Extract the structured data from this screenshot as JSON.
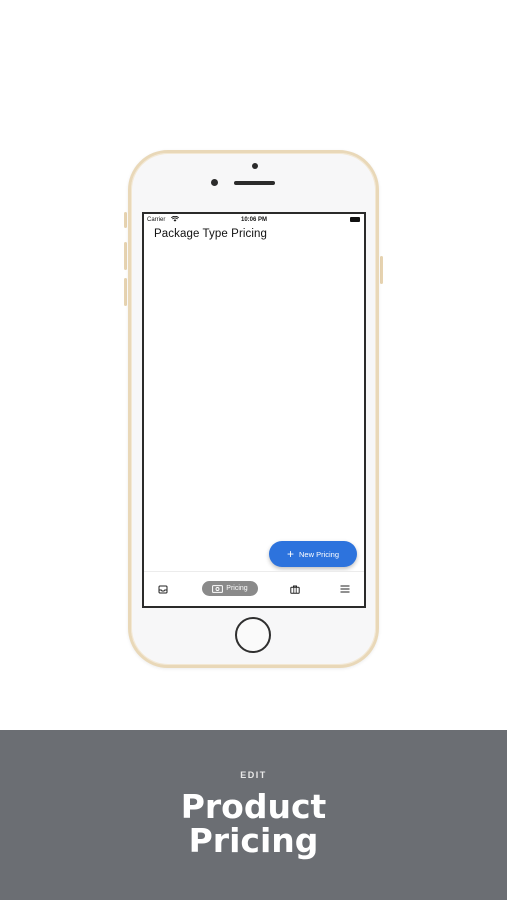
{
  "status_bar": {
    "carrier": "Carrier",
    "time": "10:06 PM"
  },
  "page": {
    "title": "Package Type Pricing"
  },
  "fab": {
    "label": "New Pricing",
    "icon": "plus-icon"
  },
  "bottom_nav": {
    "items": [
      {
        "icon": "inbox-icon",
        "label": ""
      },
      {
        "icon": "cash-icon",
        "label": "Pricing",
        "active": true
      },
      {
        "icon": "briefcase-icon",
        "label": ""
      },
      {
        "icon": "menu-icon",
        "label": ""
      }
    ]
  },
  "banner": {
    "kicker": "EDIT",
    "title_line1": "Product",
    "title_line2": "Pricing"
  },
  "colors": {
    "accent": "#2d73dd",
    "banner_bg": "#6b6e73",
    "nav_active_bg": "#8a8a8a",
    "phone_frame": "#e9d8b8"
  }
}
